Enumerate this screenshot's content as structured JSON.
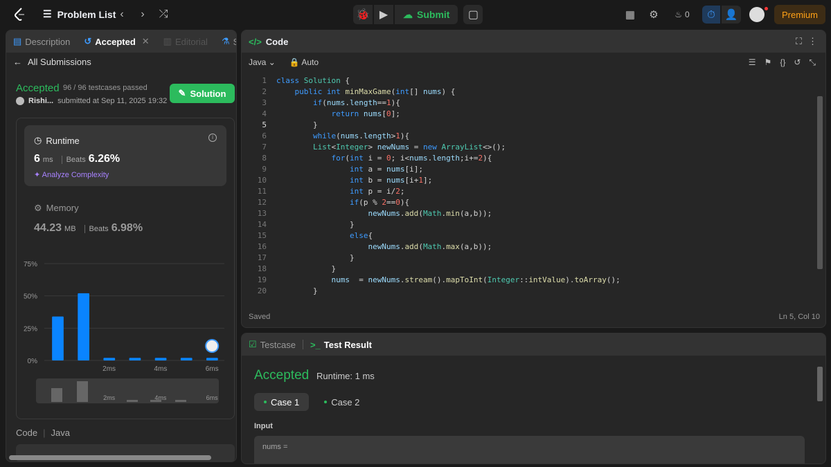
{
  "topbar": {
    "problem_list": "Problem List",
    "submit": "Submit",
    "streak": "0",
    "premium": "Premium"
  },
  "left": {
    "tabs": [
      {
        "label": "Description"
      },
      {
        "label": "Accepted"
      },
      {
        "label": "Editorial"
      },
      {
        "label": "So"
      }
    ],
    "all_submissions": "All Submissions",
    "status": "Accepted",
    "testcases": "96 / 96 testcases passed",
    "user": "Rishi...",
    "submitted": "submitted at Sep 11, 2025 19:32",
    "solution": "Solution",
    "runtime": {
      "label": "Runtime",
      "value": "6",
      "unit": "ms",
      "beats_label": "Beats",
      "beats": "6.26%",
      "analyze": "Analyze Complexity"
    },
    "memory": {
      "label": "Memory",
      "value": "44.23",
      "unit": "MB",
      "beats_label": "Beats",
      "beats": "6.98%"
    },
    "code_label": "Code",
    "lang_label": "Java"
  },
  "chart_data": {
    "type": "bar",
    "categories": [
      "0ms",
      "1ms",
      "2ms",
      "3ms",
      "4ms",
      "5ms",
      "6ms"
    ],
    "values": [
      34,
      52,
      2,
      2,
      2,
      2,
      2
    ],
    "xticks": [
      "2ms",
      "4ms",
      "6ms"
    ],
    "yticks": [
      "75%",
      "50%",
      "25%",
      "0%"
    ],
    "ylim": [
      0,
      75
    ]
  },
  "code": {
    "header": "Code",
    "language": "Java",
    "mode": "Auto",
    "status": "Saved",
    "cursor": "Ln 5, Col 10",
    "lines": [
      "class Solution {",
      "    public int minMaxGame(int[] nums) {",
      "        if(nums.length==1){",
      "            return nums[0];",
      "        }",
      "        while(nums.length>1){",
      "        List<Integer> newNums = new ArrayList<>();",
      "            for(int i = 0; i<nums.length;i+=2){",
      "                int a = nums[i];",
      "                int b = nums[i+1];",
      "                int p = i/2;",
      "                if(p % 2==0){",
      "                    newNums.add(Math.min(a,b));",
      "                }",
      "                else{",
      "                    newNums.add(Math.max(a,b));",
      "                }",
      "            }",
      "            nums  = newNums.stream().mapToInt(Integer::intValue).toArray();",
      "        }"
    ]
  },
  "test": {
    "tab_testcase": "Testcase",
    "tab_result": "Test Result",
    "status": "Accepted",
    "runtime": "Runtime: 1 ms",
    "case1": "Case 1",
    "case2": "Case 2",
    "input_label": "Input",
    "input_var": "nums ="
  }
}
